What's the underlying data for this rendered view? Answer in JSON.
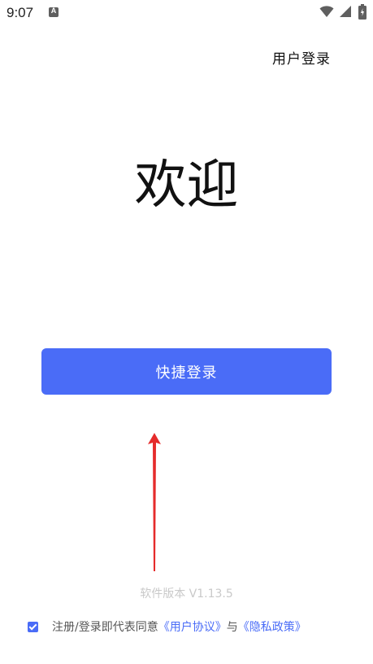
{
  "status_bar": {
    "time": "9:07",
    "notification_icon": "A",
    "icons": [
      "wifi-icon",
      "signal-icon",
      "battery-icon"
    ]
  },
  "header": {
    "login_label": "用户登录"
  },
  "main": {
    "welcome_text": "欢迎",
    "quick_login_label": "快捷登录"
  },
  "footer": {
    "version_text": "软件版本 V1.13.5",
    "agreement_prefix": "注册/登录即代表同意",
    "user_agreement": "《用户协议》",
    "conjunction": "与",
    "privacy_policy": "《隐私政策》",
    "agreement_checked": true
  },
  "colors": {
    "accent": "#4a6cf7",
    "arrow": "#e52b2b",
    "version_text": "#c9c9c9"
  }
}
